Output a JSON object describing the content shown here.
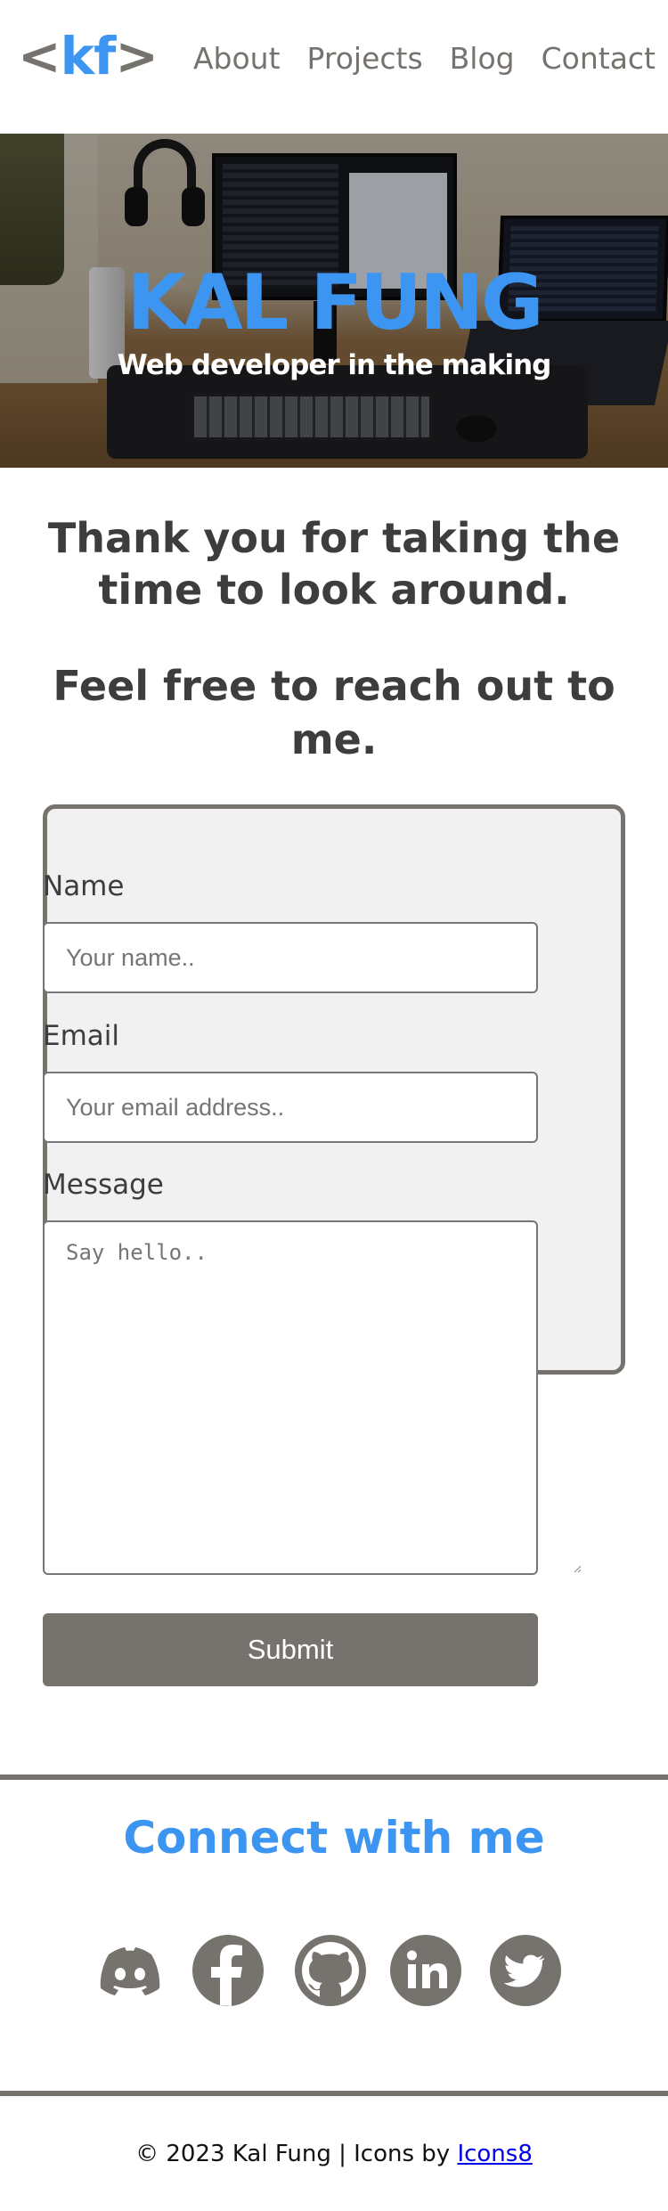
{
  "header": {
    "logo": {
      "open": "<",
      "text": "kf",
      "close": ">"
    },
    "nav": [
      "About",
      "Projects",
      "Blog",
      "Contact"
    ]
  },
  "hero": {
    "title": "KAL FUNG",
    "subtitle": "Web developer in the making"
  },
  "intro": {
    "line1": "Thank you for taking the time to look around.",
    "line2": "Feel free to reach out to me."
  },
  "form": {
    "name_label": "Name",
    "name_placeholder": "Your name..",
    "email_label": "Email",
    "email_placeholder": "Your email address..",
    "message_label": "Message",
    "message_placeholder": "Say hello..",
    "submit_label": "Submit"
  },
  "connect": {
    "title": "Connect with me",
    "icons": [
      "discord-icon",
      "facebook-icon",
      "github-icon",
      "linkedin-icon",
      "twitter-icon"
    ]
  },
  "footer": {
    "text": "© 2023 Kal Fung | Icons by ",
    "link": "Icons8"
  },
  "colors": {
    "accent": "#3d95f2",
    "gray": "#76726d",
    "text": "#3d3d3d",
    "form_bg": "#f1f1f1"
  }
}
